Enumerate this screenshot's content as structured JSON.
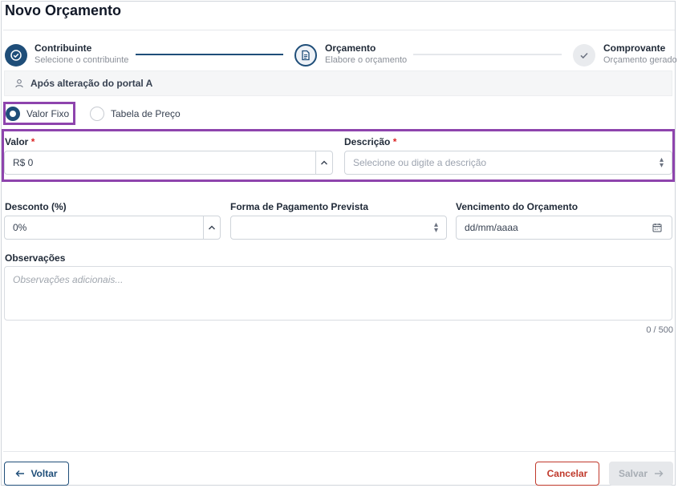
{
  "page": {
    "title": "Novo Orçamento"
  },
  "stepper": {
    "steps": [
      {
        "title": "Contribuinte",
        "subtitle": "Selecione o contribuinte",
        "state": "done"
      },
      {
        "title": "Orçamento",
        "subtitle": "Elabore o orçamento",
        "state": "current"
      },
      {
        "title": "Comprovante",
        "subtitle": "Orçamento gerado",
        "state": "pending"
      }
    ]
  },
  "taxpayer_bar": {
    "icon": "person-icon",
    "text": "Após alteração do portal A"
  },
  "pricing_mode": {
    "options": [
      {
        "label": "Valor Fixo",
        "selected": true
      },
      {
        "label": "Tabela de Preço",
        "selected": false
      }
    ]
  },
  "form": {
    "valor": {
      "label": "Valor",
      "required_mark": "*",
      "value": "R$ 0"
    },
    "descricao": {
      "label": "Descrição",
      "required_mark": "*",
      "placeholder": "Selecione ou digite a descrição"
    },
    "desconto": {
      "label": "Desconto (%)",
      "value": "0%"
    },
    "forma_pagamento": {
      "label": "Forma de Pagamento Prevista",
      "value": ""
    },
    "vencimento": {
      "label": "Vencimento do Orçamento",
      "value": "dd/mm/aaaa",
      "icon": "calendar-icon"
    },
    "observacoes": {
      "label": "Observações",
      "placeholder": "Observações adicionais...",
      "counter": "0 / 500"
    }
  },
  "footer": {
    "back_label": "Voltar",
    "cancel_label": "Cancelar",
    "save_label": "Salvar",
    "save_enabled": false
  },
  "colors": {
    "primary": "#1f4e79",
    "cancel_red": "#c0392b",
    "highlight": "#8e44ad",
    "required": "#dc2626"
  }
}
